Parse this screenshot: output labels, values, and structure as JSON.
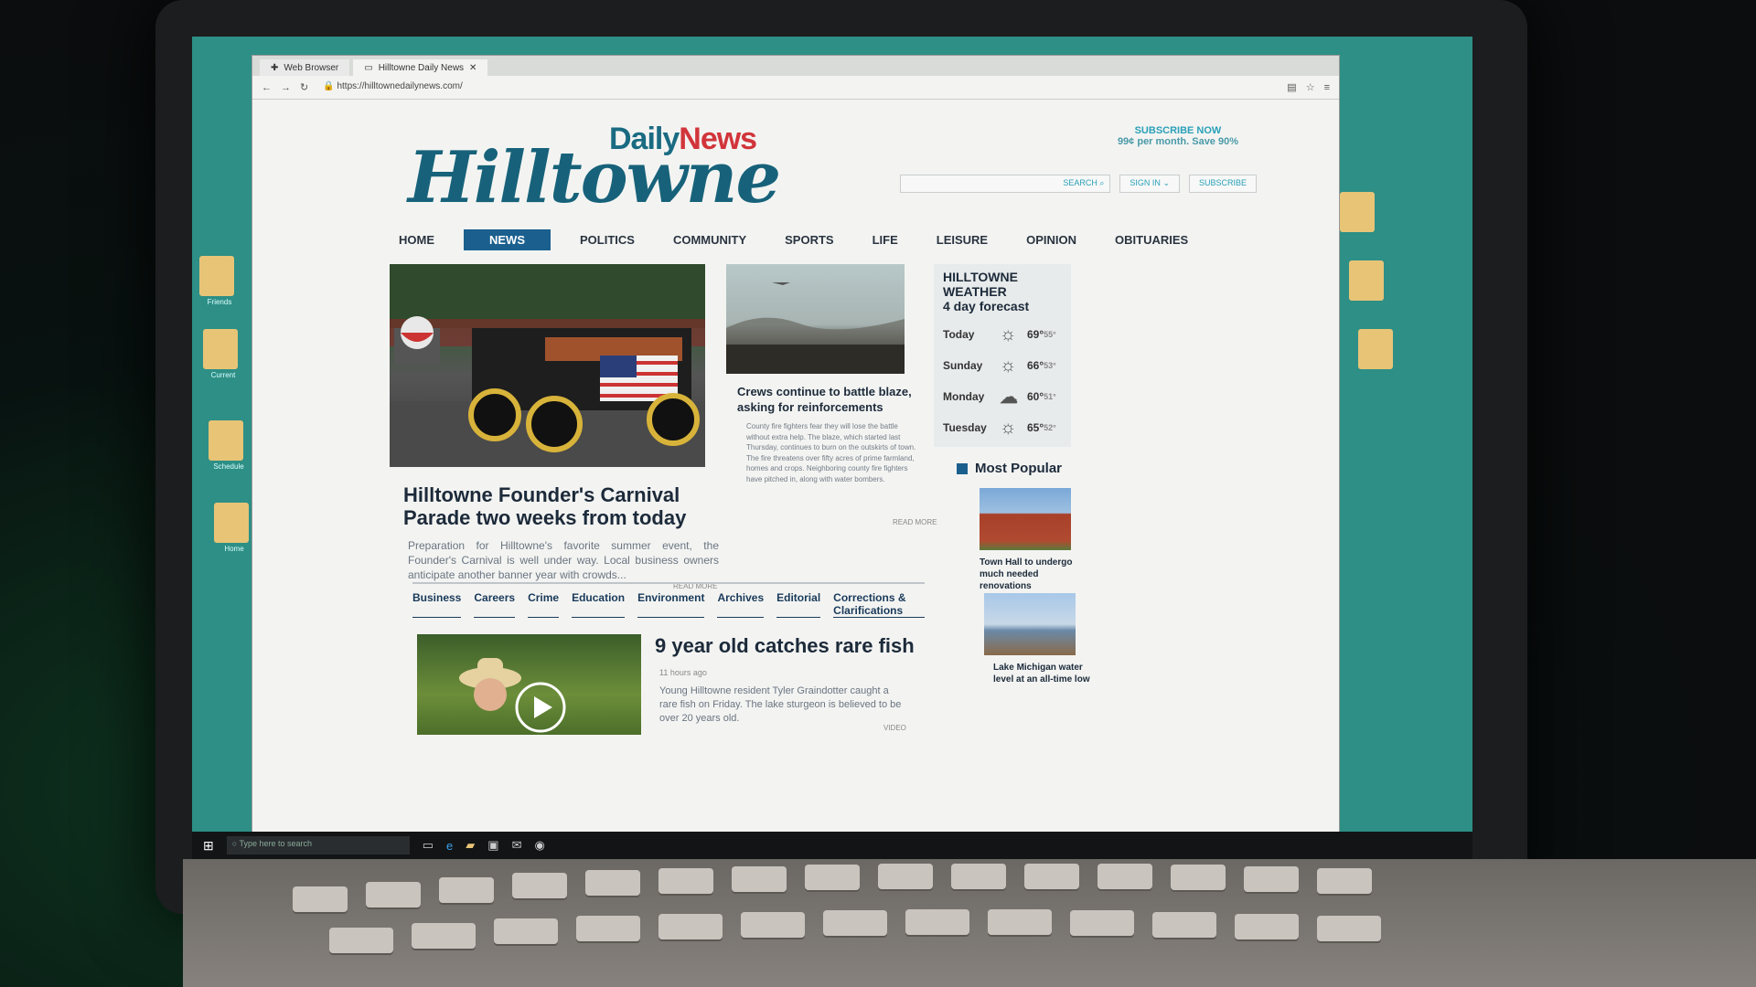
{
  "browser": {
    "tabs": [
      {
        "label": "Web Browser"
      },
      {
        "label": "Hilltowne Daily News"
      }
    ],
    "url": "https://hilltownedailynews.com/"
  },
  "masthead": {
    "brand_daily": "Daily",
    "brand_news": "News",
    "brand_main": "Hilltowne"
  },
  "promo": {
    "line1": "SUBSCRIBE NOW",
    "line2": "99¢ per month. Save 90%"
  },
  "search": {
    "placeholder": "SEARCH",
    "signin_label": "SIGN IN",
    "subscribe_label": "SUBSCRIBE"
  },
  "nav": {
    "items": [
      "HOME",
      "NEWS",
      "POLITICS",
      "COMMUNITY",
      "SPORTS",
      "LIFE",
      "LEISURE",
      "OPINION",
      "OBITUARIES"
    ],
    "active": "NEWS"
  },
  "hero": {
    "title": "Hilltowne Founder's Carnival Parade two weeks from today",
    "summary": "Preparation for Hilltowne's favorite summer event, the Founder's Carnival is well under way. Local business owners anticipate another banner year with crowds...",
    "read_more": "READ MORE"
  },
  "fire_story": {
    "title": "Crews continue to battle blaze, asking for reinforcements",
    "summary": "County fire fighters fear they will lose the battle without extra help. The blaze, which started last Thursday, continues to burn on the outskirts of town. The fire threatens over fifty acres of prime farmland, homes and crops. Neighboring county fire fighters have pitched in, along with water bombers.",
    "read_more": "READ MORE"
  },
  "weather": {
    "title": "HILLTOWNE WEATHER",
    "subtitle": "4 day forecast",
    "days": [
      {
        "day": "Today",
        "icon": "sun-icon",
        "high": "69°",
        "low": "55°"
      },
      {
        "day": "Sunday",
        "icon": "sun-icon",
        "high": "66°",
        "low": "53°"
      },
      {
        "day": "Monday",
        "icon": "cloud-sun-icon",
        "high": "60°",
        "low": "51°"
      },
      {
        "day": "Tuesday",
        "icon": "sun-icon",
        "high": "65°",
        "low": "52°"
      }
    ]
  },
  "popular": {
    "heading": "Most Popular",
    "items": [
      {
        "caption": "Town Hall to undergo much needed renovations"
      },
      {
        "caption": "Lake Michigan water level at an all-time low"
      }
    ]
  },
  "topics": [
    "Business",
    "Careers",
    "Crime",
    "Education",
    "Environment",
    "Archives",
    "Editorial",
    "Corrections & Clarifications"
  ],
  "fish_story": {
    "title": "9 year old catches rare fish",
    "age": "11 hours ago",
    "summary": "Young Hilltowne resident Tyler Graindotter caught a rare fish on Friday. The lake sturgeon is believed to be over 20 years old.",
    "video_label": "VIDEO"
  },
  "taskbar": {
    "search_placeholder": "Type here to search"
  },
  "desktop_icons": [
    "Friends",
    "Current",
    "Schedule",
    "Home"
  ],
  "colors": {
    "brand": "#17627a",
    "accent_red": "#d1353b",
    "nav_active": "#1a5f8e"
  }
}
